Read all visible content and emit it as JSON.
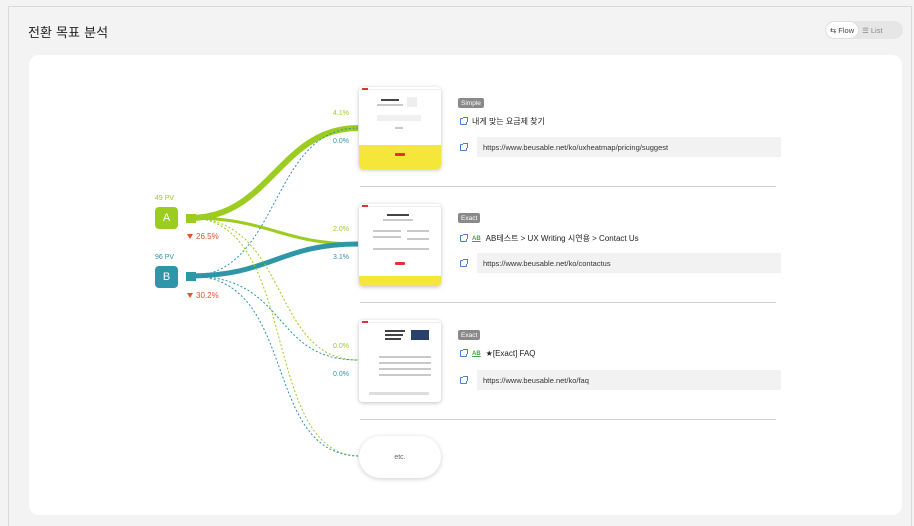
{
  "header": {
    "title": "전환 목표 분석",
    "view_toggle": {
      "flow_label": "Flow",
      "list_label": "List",
      "active": "Flow"
    }
  },
  "colors": {
    "variant_a": "#9ccc1f",
    "variant_b": "#2f95a8",
    "drop": "#e0542c",
    "guide": "#4a7fd0"
  },
  "variants": [
    {
      "label": "A",
      "pv": "49 PV",
      "drop_rate": "26.5%"
    },
    {
      "label": "B",
      "pv": "96 PV",
      "drop_rate": "30.2%"
    }
  ],
  "goals": [
    {
      "match": "Simple",
      "title": "내게 맞는 요금제 찾기",
      "ab": false,
      "url": "https://www.beusable.net/ko/uxheatmap/pricing/suggest",
      "rate_a": "4.1%",
      "rate_b": "0.0%"
    },
    {
      "match": "Exact",
      "title": "AB테스트 > UX Writing 시연용 > Contact Us",
      "ab": true,
      "ab_label": "AB",
      "url": "https://www.beusable.net/ko/contactus",
      "rate_a": "2.0%",
      "rate_b": "3.1%"
    },
    {
      "match": "Exact",
      "title": "★[Exact] FAQ",
      "ab": true,
      "ab_label": "AB",
      "url": "https://www.beusable.net/ko/faq",
      "rate_a": "0.0%",
      "rate_b": "0.0%"
    }
  ],
  "etc_label": "etc."
}
